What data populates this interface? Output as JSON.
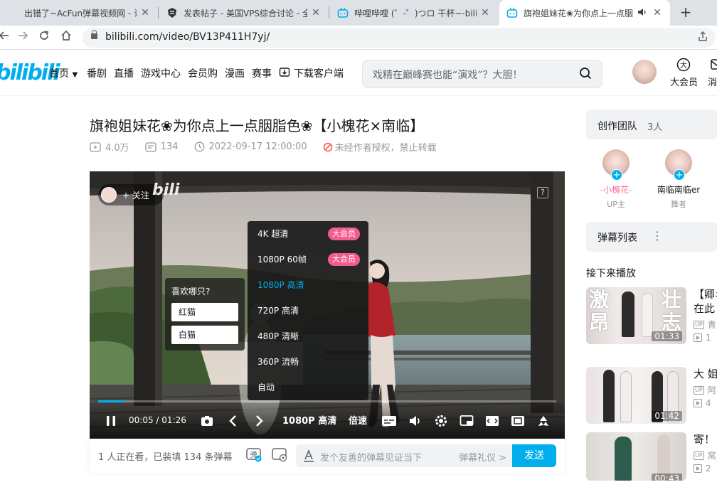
{
  "browser": {
    "tabs": [
      {
        "title": "出错了~AcFun弹幕视频网 - 认真",
        "icon": "acfun-icon"
      },
      {
        "title": "发表帖子 - 美国VPS综合讨论 - 全",
        "icon": "forum-icon"
      },
      {
        "title": "哔哩哔哩 (゜-゜)つロ 干杯~-bili",
        "icon": "bilibili-tv-icon"
      },
      {
        "title": "旗袍姐妹花❀为你点上一点胭",
        "icon": "bilibili-tv-icon",
        "active": true
      }
    ],
    "close_glyph": "✕",
    "new_tab_glyph": "+",
    "url": "bilibili.com/video/BV13P411H7yj/"
  },
  "header": {
    "logo": "bilibili",
    "nav": [
      "首页",
      "番剧",
      "直播",
      "游戏中心",
      "会员购",
      "漫画",
      "赛事",
      "下载客户端"
    ],
    "search_placeholder": "戏精在巅峰赛也能“演戏”？大胆！",
    "vip_label": "大会员",
    "message_label": "消"
  },
  "video": {
    "title": "旗袍姐妹花❀为你点上一点胭脂色❀【小槐花×南临】",
    "views": "4.0万",
    "danmaku_count": "134",
    "date": "2022-09-17 12:00:00",
    "copyright": "未经作者授权，禁止转载"
  },
  "player": {
    "follow_label": "+ 关注",
    "watermark": "bili",
    "help": "?",
    "vote": {
      "question": "喜欢哪只?",
      "options": [
        "红猫",
        "白猫"
      ]
    },
    "quality_menu": [
      {
        "label": "4K 超清",
        "badge": "大会员"
      },
      {
        "label": "1080P 60帧",
        "badge": "大会员"
      },
      {
        "label": "1080P 高清",
        "selected": true
      },
      {
        "label": "720P 高清"
      },
      {
        "label": "480P 清晰"
      },
      {
        "label": "360P 流畅"
      },
      {
        "label": "自动"
      }
    ],
    "time_current": "00:05",
    "time_sep": "/",
    "time_total": "01:26",
    "progress_fraction": 0.058,
    "quality_label": "1080P 高清",
    "speed_label": "倍速"
  },
  "danmaku_bar": {
    "watching": "1 人正在看，已装填 134 条弹幕",
    "placeholder": "发个友善的弹幕见证当下",
    "etiquette": "弹幕礼仪 >",
    "send": "发送"
  },
  "sidebar": {
    "team_title": "创作团队",
    "team_count": "3人",
    "members": [
      {
        "name": "-小槐花-",
        "role": "UP主",
        "color": "#fb7299"
      },
      {
        "name": "南临南临er",
        "role": "舞者",
        "color": "#18191c"
      }
    ],
    "danmaku_list_title": "弹幕列表",
    "danmaku_list_more": "⋮",
    "next_title": "接下来播放",
    "recommendations": [
      {
        "title": "【卿斗",
        "title2": "在此",
        "duration": "01:33",
        "up": "青",
        "plays": "1",
        "thumb_text_left": "激\n昂",
        "thumb_text_right": "壮\n志"
      },
      {
        "title": "大 姐",
        "title2": "",
        "duration": "01:42",
        "up": "阿",
        "plays": "4"
      },
      {
        "title": "寄！",
        "title2": "",
        "duration": "00:43",
        "up": "窝",
        "plays": "2"
      }
    ]
  },
  "colors": {
    "bili_blue": "#00aeec",
    "bili_pink": "#fb7299",
    "vip_badge": "#f25d8e"
  }
}
